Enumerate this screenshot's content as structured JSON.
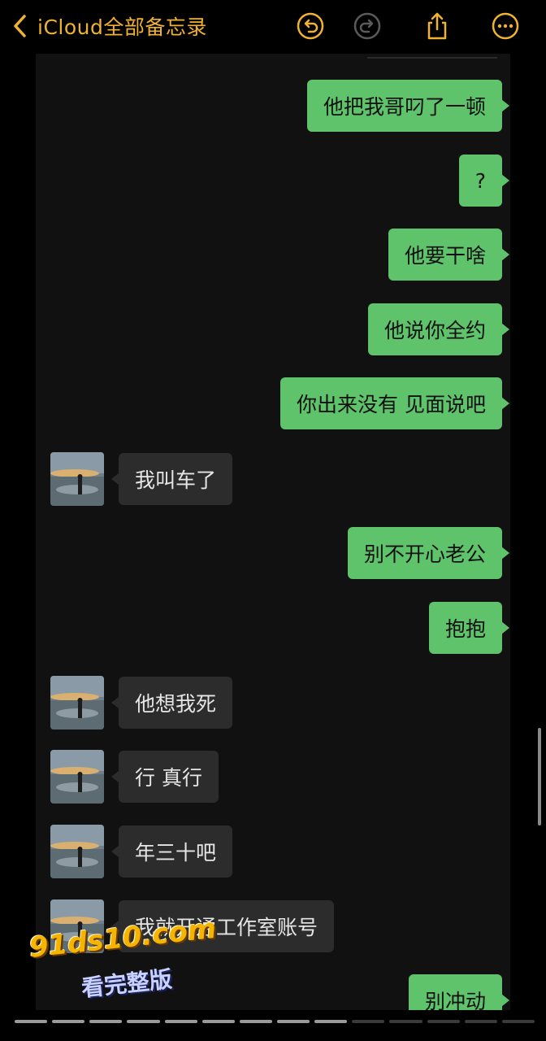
{
  "nav": {
    "back_label": "iCloud全部备忘录",
    "icons": [
      "back-chevron-icon",
      "undo-icon",
      "redo-icon",
      "share-icon",
      "more-icon"
    ],
    "accent_color": "#f0b232"
  },
  "chat": {
    "outgoing_color": "#5ec36a",
    "incoming_color": "#2c2c2c",
    "messages": [
      {
        "side": "out",
        "text": "他把我哥叼了一顿"
      },
      {
        "side": "out",
        "text": "?"
      },
      {
        "side": "out",
        "text": "他要干啥"
      },
      {
        "side": "out",
        "text": "他说你全约"
      },
      {
        "side": "out",
        "text": "你出来没有 见面说吧"
      },
      {
        "side": "in",
        "text": "我叫车了"
      },
      {
        "side": "out",
        "text": "别不开心老公"
      },
      {
        "side": "out",
        "text": "抱抱"
      },
      {
        "side": "in",
        "text": "他想我死"
      },
      {
        "side": "in",
        "text": "行 真行"
      },
      {
        "side": "in",
        "text": "年三十吧"
      },
      {
        "side": "in",
        "text": "我就开通工作室账号"
      },
      {
        "side": "out",
        "text": "别冲动"
      }
    ]
  },
  "watermark": {
    "line1": "91ds10.com",
    "line2": "看完整版"
  }
}
